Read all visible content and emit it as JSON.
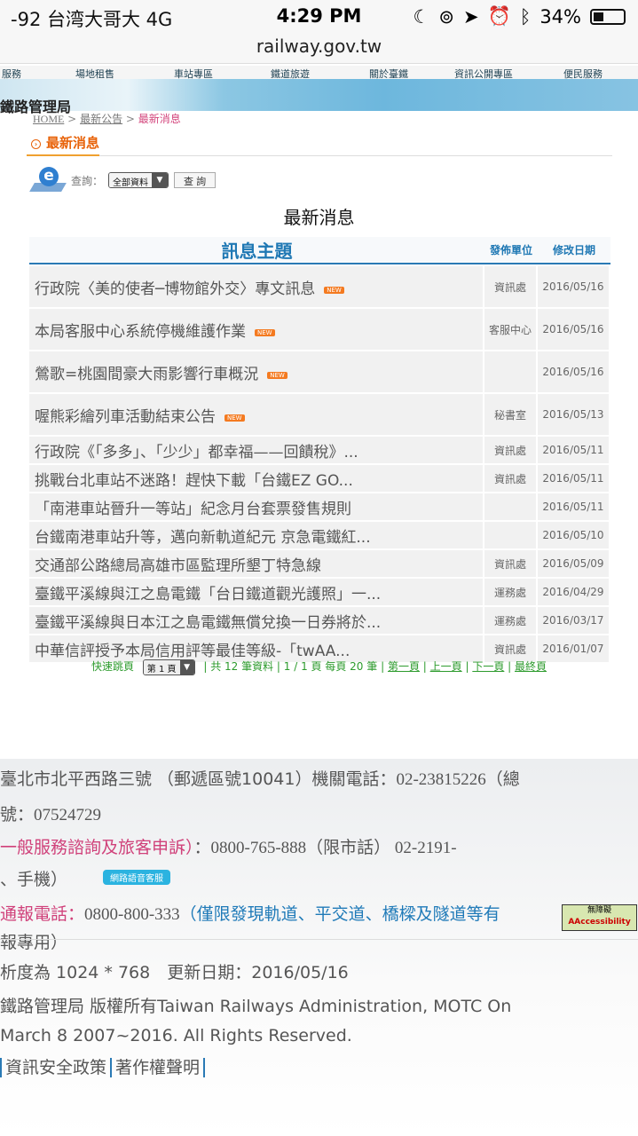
{
  "status_bar": {
    "carrier": "-92 台湾大哥大  4G",
    "time": "4:29 PM",
    "battery": "34%",
    "battery_level": 0.34
  },
  "url": "railway.gov.tw",
  "nav": [
    "服務",
    "場地租售",
    "車站專區",
    "鐵道旅遊",
    "關於臺鐵",
    "資訊公開專區",
    "便民服務"
  ],
  "banner_title": "鐵路管理局",
  "breadcrumb": {
    "home": "HOME",
    "sep": ">",
    "parent": "最新公告",
    "current": "最新消息"
  },
  "section_title": "最新消息",
  "query": {
    "label": "查詢：",
    "select": "全部資料",
    "button": "查 詢"
  },
  "main_title": "最新消息",
  "table": {
    "headers": [
      "訊息主題",
      "發佈單位",
      "修改日期"
    ],
    "new_badge": "NEW",
    "rows": [
      {
        "title": "行政院〈美的使者─博物館外交〉專文訊息",
        "unit": "資訊處",
        "date": "2016/05/16",
        "new": true
      },
      {
        "title": "本局客服中心系統停機維護作業",
        "unit": "客服中心",
        "date": "2016/05/16",
        "new": true
      },
      {
        "title": "鶯歌=桃園間豪大雨影響行車概況",
        "unit": "",
        "date": "2016/05/16",
        "new": true
      },
      {
        "title": "喔熊彩繪列車活動結束公告",
        "unit": "秘書室",
        "date": "2016/05/13",
        "new": true
      },
      {
        "title": "行政院《「多多」、「少少」都幸福——回饋稅》...",
        "unit": "資訊處",
        "date": "2016/05/11",
        "new": false
      },
      {
        "title": "挑戰台北車站不迷路！趕快下載「台鐵EZ GO...",
        "unit": "資訊處",
        "date": "2016/05/11",
        "new": false
      },
      {
        "title": "「南港車站晉升一等站」紀念月台套票發售規則",
        "unit": "",
        "date": "2016/05/11",
        "new": false
      },
      {
        "title": "台鐵南港車站升等，邁向新軌道紀元 京急電鐵紅...",
        "unit": "",
        "date": "2016/05/10",
        "new": false
      },
      {
        "title": "交通部公路總局高雄市區監理所墾丁特急線",
        "unit": "資訊處",
        "date": "2016/05/09",
        "new": false
      },
      {
        "title": "臺鐵平溪線與江之島電鐵「台日鐵道觀光護照」一...",
        "unit": "運務處",
        "date": "2016/04/29",
        "new": false
      },
      {
        "title": "臺鐵平溪線與日本江之島電鐵無償兌換一日券將於...",
        "unit": "運務處",
        "date": "2016/03/17",
        "new": false
      },
      {
        "title": "中華信評授予本局信用評等最佳等級-「twAA...",
        "unit": "資訊處",
        "date": "2016/01/07",
        "new": false
      }
    ]
  },
  "pager": {
    "jump_label": "快速跳頁",
    "page_select": "第 1 頁",
    "summary": "| 共 12 筆資料 | 1 / 1 頁  每頁 20 筆 |",
    "first": "第一頁",
    "prev": "上一頁",
    "next": "下一頁",
    "last": "最終頁"
  },
  "footer": {
    "address": "臺北市北平西路三號 （郵遞區號10041）機關電話：",
    "phone": "02-23815226（總",
    "line2a": "號：",
    "line2b": "07524729",
    "service_label": "一般服務諮詢及旅客申訴）",
    "service_colon": "：",
    "service_phone": "0800-765-888（限市話） 02-2191-",
    "line4": "、手機）",
    "chat_button": "網路語音客服",
    "report_label": "通報電話：",
    "report_phone": "0800-800-333",
    "report_note": "（僅限發現軌道、平交道、橋樑及隧道等有",
    "report_note2": "報專用）",
    "accessibility_top": "無障礙",
    "accessibility_bottom": "AAccessibility",
    "resolution": "析度為 1024 * 768　更新日期：2016/05/16",
    "copyright1": "鐵路管理局 版權所有Taiwan Railways Administration, MOTC On",
    "copyright2": "March 8 2007~2016. All Rights Reserved.",
    "links": [
      "資訊安全政策",
      "著作權聲明"
    ]
  }
}
